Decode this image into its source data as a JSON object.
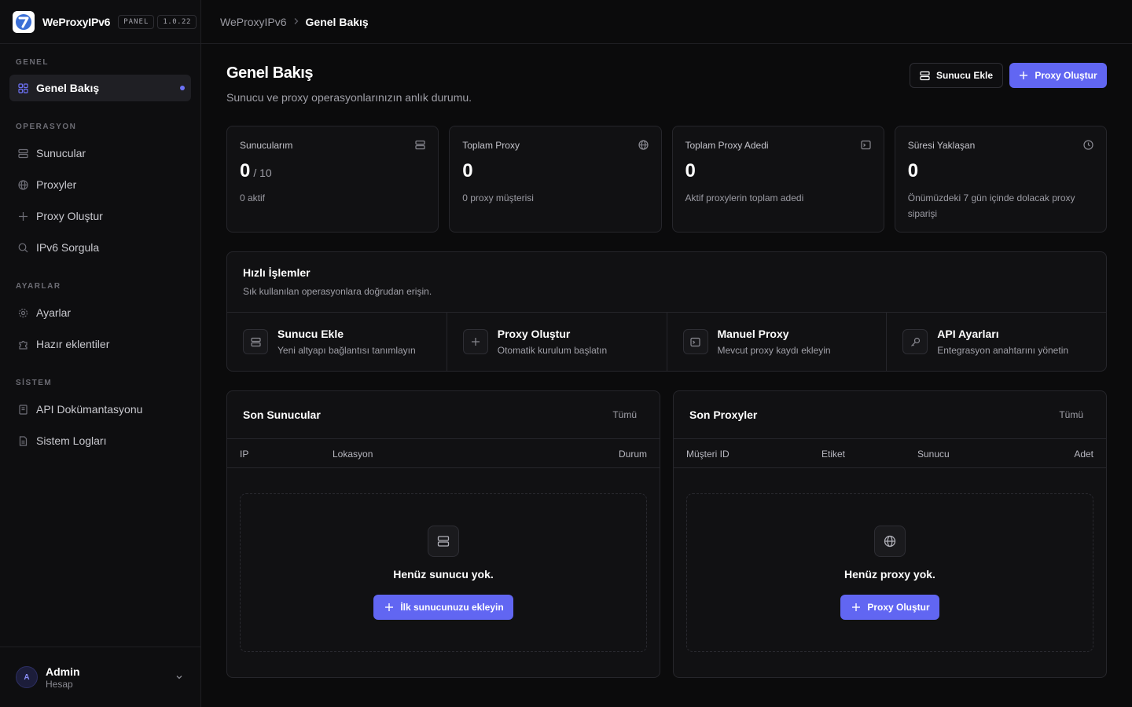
{
  "brand": {
    "name": "WeProxyIPv6",
    "tag": "PANEL",
    "version": "1.0.22"
  },
  "sidebar": {
    "sections": [
      {
        "label": "GENEL",
        "items": [
          {
            "label": "Genel Bakış",
            "icon": "grid-icon",
            "active": true
          }
        ]
      },
      {
        "label": "OPERASYON",
        "items": [
          {
            "label": "Sunucular",
            "icon": "server-icon"
          },
          {
            "label": "Proxyler",
            "icon": "globe-icon"
          },
          {
            "label": "Proxy Oluştur",
            "icon": "plus-icon"
          },
          {
            "label": "IPv6 Sorgula",
            "icon": "search-icon"
          }
        ]
      },
      {
        "label": "AYARLAR",
        "items": [
          {
            "label": "Ayarlar",
            "icon": "gear-icon"
          },
          {
            "label": "Hazır eklentiler",
            "icon": "puzzle-icon"
          }
        ]
      },
      {
        "label": "SİSTEM",
        "items": [
          {
            "label": "API Dokümantasyonu",
            "icon": "book-icon"
          },
          {
            "label": "Sistem Logları",
            "icon": "file-icon"
          }
        ]
      }
    ]
  },
  "user": {
    "initial": "A",
    "name": "Admin",
    "role": "Hesap"
  },
  "breadcrumb": {
    "root": "WeProxyIPv6",
    "current": "Genel Bakış"
  },
  "page": {
    "title": "Genel Bakış",
    "subtitle": "Sunucu ve proxy operasyonlarınızın anlık durumu.",
    "add_server_label": "Sunucu Ekle",
    "create_proxy_label": "Proxy Oluştur"
  },
  "stats": [
    {
      "label": "Sunucularım",
      "value": "0",
      "suffix": "/ 10",
      "desc": "0 aktif",
      "icon": "server-icon"
    },
    {
      "label": "Toplam Proxy",
      "value": "0",
      "suffix": "",
      "desc": "0 proxy müşterisi",
      "icon": "globe-icon"
    },
    {
      "label": "Toplam Proxy Adedi",
      "value": "0",
      "suffix": "",
      "desc": "Aktif proxylerin toplam adedi",
      "icon": "terminal-icon"
    },
    {
      "label": "Süresi Yaklaşan",
      "value": "0",
      "suffix": "",
      "desc": "Önümüzdeki 7 gün içinde dolacak proxy siparişi",
      "icon": "clock-icon"
    }
  ],
  "quick": {
    "title": "Hızlı İşlemler",
    "subtitle": "Sık kullanılan operasyonlara doğrudan erişin.",
    "actions": [
      {
        "title": "Sunucu Ekle",
        "sub": "Yeni altyapı bağlantısı tanımlayın",
        "icon": "server-icon"
      },
      {
        "title": "Proxy Oluştur",
        "sub": "Otomatik kurulum başlatın",
        "icon": "plus-icon"
      },
      {
        "title": "Manuel Proxy",
        "sub": "Mevcut proxy kaydı ekleyin",
        "icon": "terminal-icon"
      },
      {
        "title": "API Ayarları",
        "sub": "Entegrasyon anahtarını yönetin",
        "icon": "key-icon"
      }
    ]
  },
  "servers_panel": {
    "title": "Son Sunucular",
    "link": "Tümü",
    "columns": [
      "IP",
      "Lokasyon",
      "Durum"
    ],
    "empty_text": "Henüz sunucu yok.",
    "empty_button": "İlk sunucunuzu ekleyin"
  },
  "proxies_panel": {
    "title": "Son Proxyler",
    "link": "Tümü",
    "columns": [
      "Müşteri ID",
      "Etiket",
      "Sunucu",
      "Adet"
    ],
    "empty_text": "Henüz proxy yok.",
    "empty_button": "Proxy Oluştur"
  },
  "colors": {
    "accent": "#6166f2",
    "background": "#0b0b0c",
    "card": "#111113",
    "border": "#26262b"
  }
}
